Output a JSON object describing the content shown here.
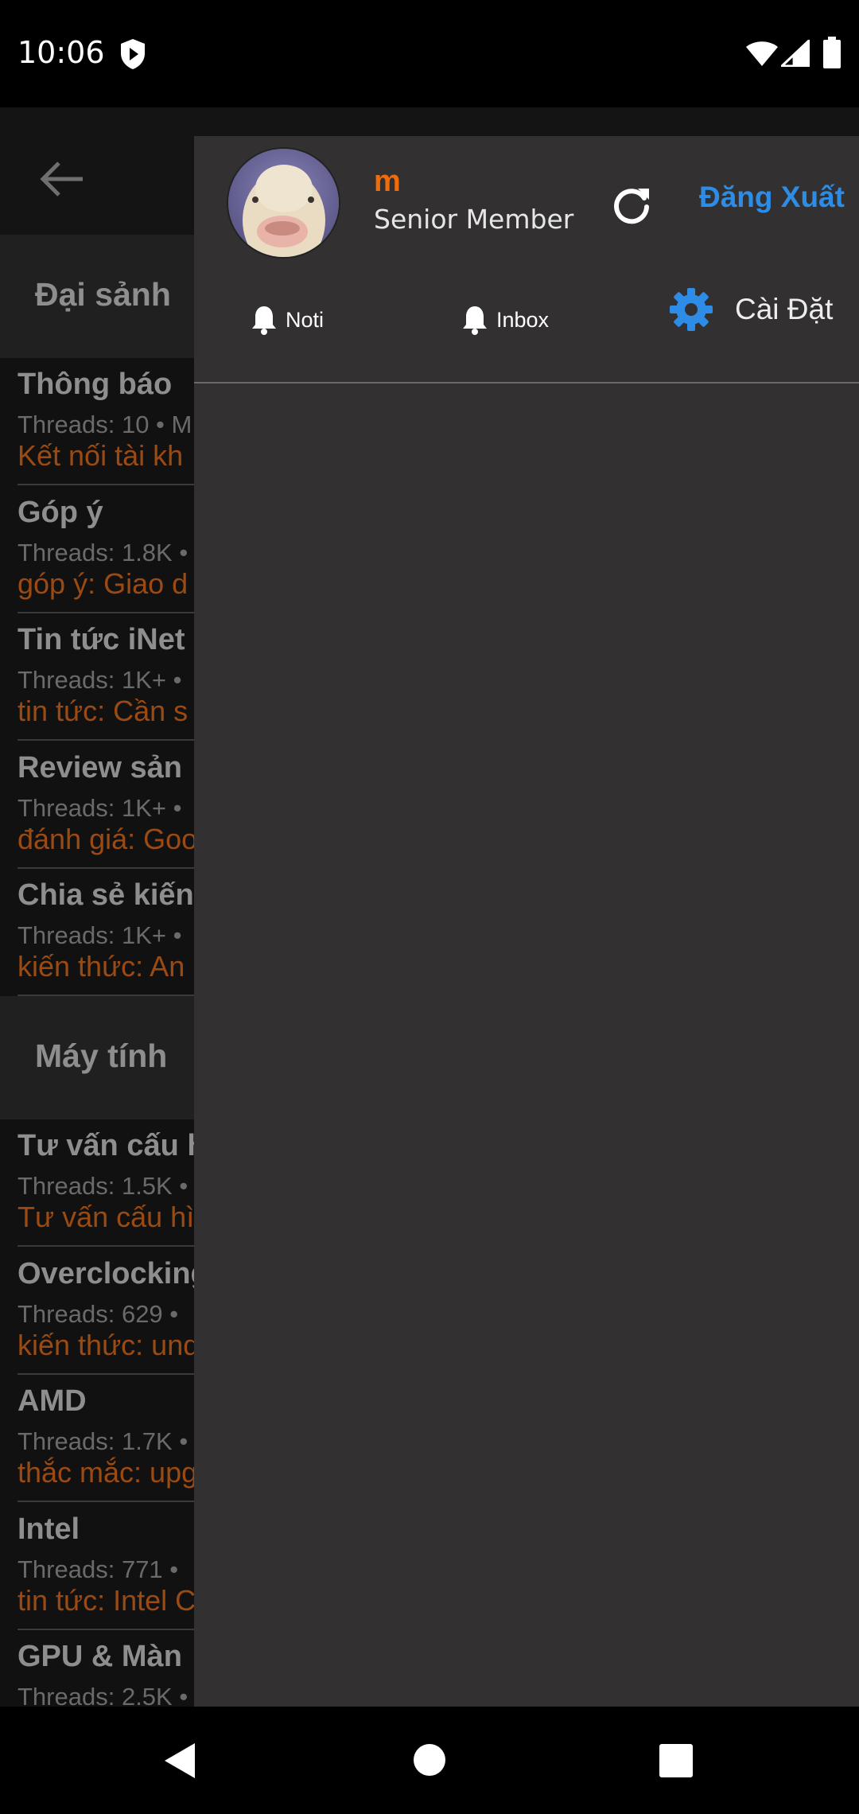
{
  "status_bar": {
    "time": "10:06",
    "icons": [
      "shield-play-icon",
      "wifi-icon",
      "signal-icon",
      "battery-icon"
    ]
  },
  "background": {
    "sections": [
      {
        "title": "Đại sảnh",
        "items": [
          {
            "title": "Thông báo",
            "meta": "Threads: 10 • M",
            "latest": "Kết nối tài kh"
          },
          {
            "title": "Góp ý",
            "meta": "Threads: 1.8K •",
            "latest": "góp ý: Giao d"
          },
          {
            "title": "Tin tức iNet",
            "meta": "Threads: 1K+ •",
            "latest": "tin tức: Cần s"
          },
          {
            "title": "Review sản",
            "meta": "Threads: 1K+ •",
            "latest": "đánh giá: Goo"
          },
          {
            "title": "Chia sẻ kiến",
            "meta": "Threads: 1K+ •",
            "latest": "kiến thức: An"
          }
        ]
      },
      {
        "title": "Máy tính",
        "items": [
          {
            "title": "Tư vấn cấu h",
            "meta": "Threads: 1.5K •",
            "latest": "Tư vấn cấu hì"
          },
          {
            "title": "Overclocking",
            "meta": "Threads: 629 •",
            "latest": "kiến thức: und"
          },
          {
            "title": "AMD",
            "meta": "Threads: 1.7K •",
            "latest": "thắc mắc: upg"
          },
          {
            "title": "Intel",
            "meta": "Threads: 771 •",
            "latest": "tin tức: Intel C"
          },
          {
            "title": "GPU & Màn",
            "meta": "Threads: 2.5K •",
            "latest": ""
          }
        ]
      }
    ]
  },
  "drawer": {
    "user": {
      "name": "m",
      "rank": "Senior Member"
    },
    "logout_label": "Đăng Xuất",
    "tabs": [
      {
        "label": "Noti",
        "icon": "bell-icon"
      },
      {
        "label": "Inbox",
        "icon": "bell-icon"
      }
    ],
    "settings_label": "Cài Đặt"
  },
  "colors": {
    "accent_blue": "#2d8ce6",
    "username_orange": "#ee6c0c",
    "latest_orange": "#9a4a12",
    "drawer_bg": "#323030"
  }
}
